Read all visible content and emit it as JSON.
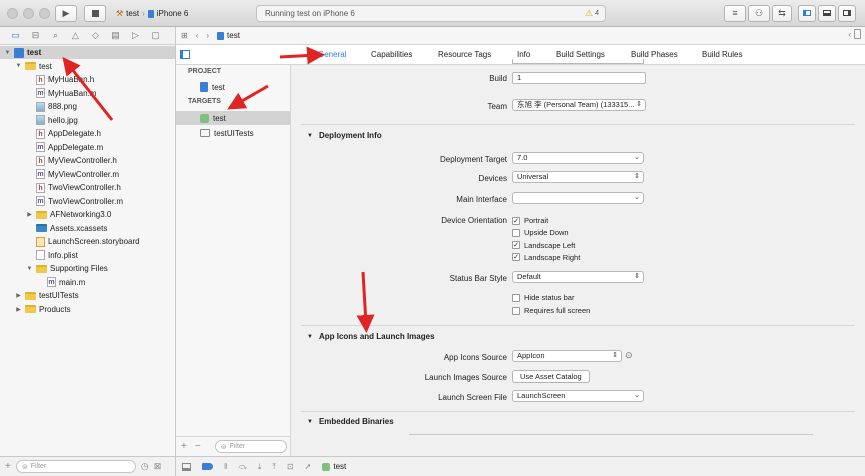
{
  "toolbar": {
    "scheme_name": "test",
    "device_name": "iPhone 6",
    "activity_text": "Running test on iPhone 6",
    "warning_count": "4"
  },
  "navigator": {
    "items": [
      {
        "label": "test",
        "kind": "project",
        "depth": 0,
        "disclosure": "open",
        "selected": true
      },
      {
        "label": "test",
        "kind": "folder",
        "depth": 1,
        "disclosure": "open"
      },
      {
        "label": "MyHuaBan.h",
        "kind": "h",
        "depth": 2
      },
      {
        "label": "MyHuaBan.m",
        "kind": "m",
        "depth": 2
      },
      {
        "label": "888.png",
        "kind": "img",
        "depth": 2
      },
      {
        "label": "hello.jpg",
        "kind": "img",
        "depth": 2
      },
      {
        "label": "AppDelegate.h",
        "kind": "h",
        "depth": 2
      },
      {
        "label": "AppDelegate.m",
        "kind": "m",
        "depth": 2
      },
      {
        "label": "MyViewController.h",
        "kind": "h",
        "depth": 2
      },
      {
        "label": "MyViewController.m",
        "kind": "m",
        "depth": 2
      },
      {
        "label": "TwoViewController.h",
        "kind": "h",
        "depth": 2
      },
      {
        "label": "TwoViewController.m",
        "kind": "m",
        "depth": 2
      },
      {
        "label": "AFNetworking3.0",
        "kind": "folder",
        "depth": 2,
        "disclosure": "closed"
      },
      {
        "label": "Assets.xcassets",
        "kind": "assets",
        "depth": 2
      },
      {
        "label": "LaunchScreen.storyboard",
        "kind": "sb",
        "depth": 2
      },
      {
        "label": "Info.plist",
        "kind": "plist",
        "depth": 2
      },
      {
        "label": "Supporting Files",
        "kind": "folder",
        "depth": 2,
        "disclosure": "open"
      },
      {
        "label": "main.m",
        "kind": "m",
        "depth": 3
      },
      {
        "label": "testUITests",
        "kind": "folder",
        "depth": 1,
        "disclosure": "closed"
      },
      {
        "label": "Products",
        "kind": "folder",
        "depth": 1,
        "disclosure": "closed"
      }
    ],
    "filter_placeholder": "Filter"
  },
  "jumpbar": {
    "crumb": "test"
  },
  "tabs": [
    "General",
    "Capabilities",
    "Resource Tags",
    "Info",
    "Build Settings",
    "Build Phases",
    "Build Rules"
  ],
  "selected_tab": "General",
  "target_list": {
    "project_header": "PROJECT",
    "project_item": "test",
    "targets_header": "TARGETS",
    "targets": [
      "test",
      "testUITests"
    ],
    "filter_placeholder": "Filter"
  },
  "settings": {
    "build_label": "Build",
    "build_value": "1",
    "team_label": "Team",
    "team_value": "东旭 李 (Personal Team) (133315...",
    "deployment_section": "Deployment Info",
    "deployment_target_label": "Deployment Target",
    "deployment_target_value": "7.0",
    "devices_label": "Devices",
    "devices_value": "Universal",
    "main_interface_label": "Main Interface",
    "main_interface_value": "",
    "orientation_label": "Device Orientation",
    "orientations": [
      {
        "label": "Portrait",
        "checked": true
      },
      {
        "label": "Upside Down",
        "checked": false
      },
      {
        "label": "Landscape Left",
        "checked": true
      },
      {
        "label": "Landscape Right",
        "checked": true
      }
    ],
    "status_bar_label": "Status Bar Style",
    "status_bar_value": "Default",
    "hide_status_bar": "Hide status bar",
    "requires_full_screen": "Requires full screen",
    "icons_section": "App Icons and Launch Images",
    "app_icons_label": "App Icons Source",
    "app_icons_value": "AppIcon",
    "launch_images_label": "Launch Images Source",
    "launch_images_button": "Use Asset Catalog",
    "launch_screen_label": "Launch Screen File",
    "launch_screen_value": "LaunchScreen",
    "embedded_section": "Embedded Binaries"
  },
  "debugbar": {
    "target": "test"
  },
  "colors": {
    "annotation_arrow": "#e02424",
    "accent": "#2f7ae5"
  }
}
